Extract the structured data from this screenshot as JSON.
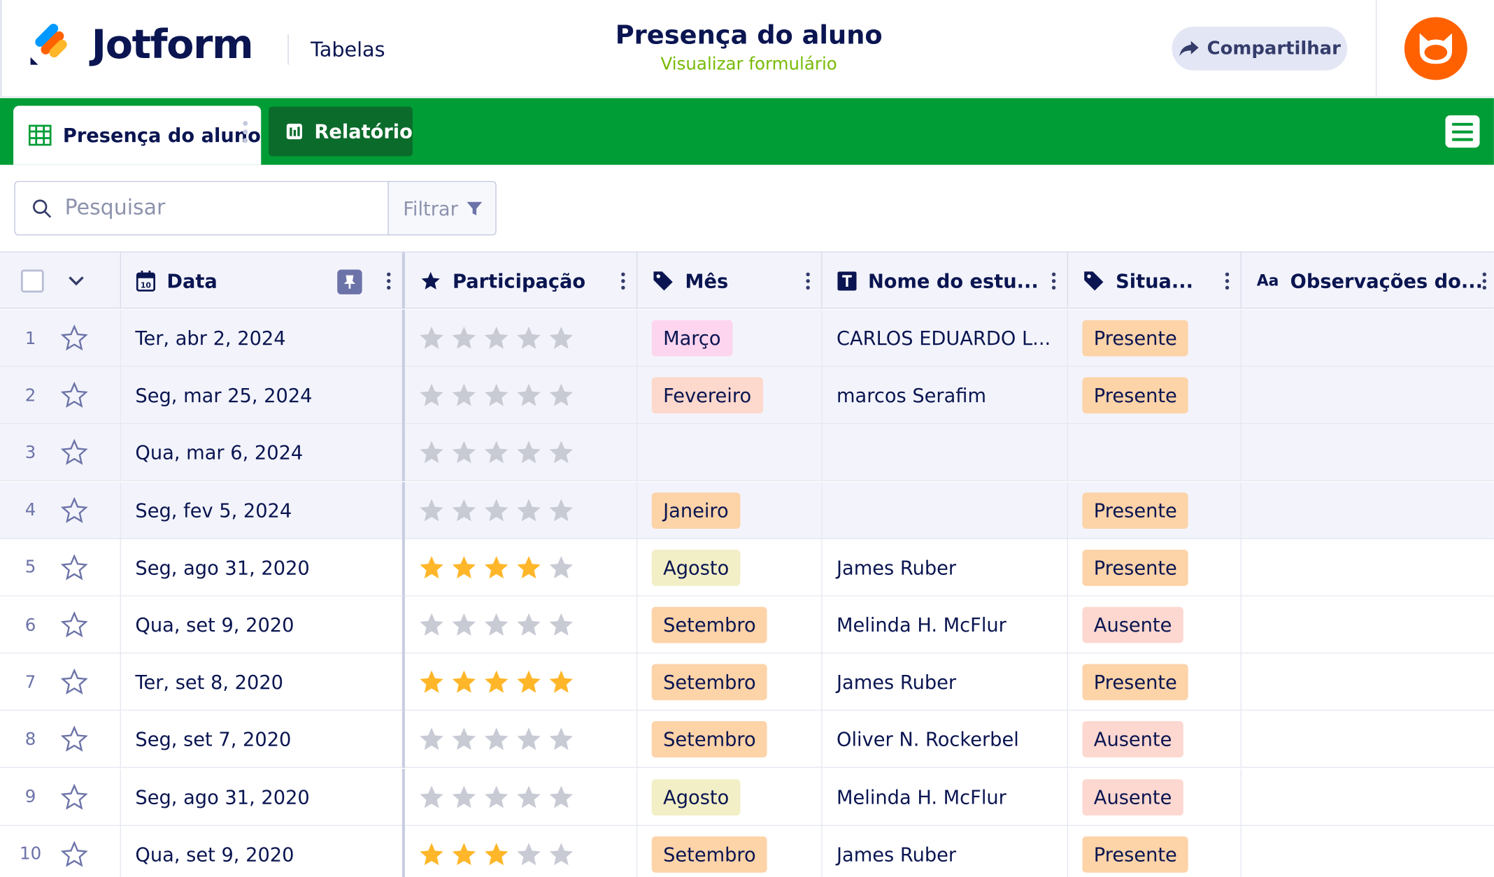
{
  "header": {
    "brand": "Jotform",
    "section": "Tabelas",
    "title": "Presença do aluno",
    "subtitle": "Visualizar formulário",
    "share_label": "Compartilhar"
  },
  "tabs": [
    {
      "label": "Presença do aluno"
    },
    {
      "label": "Relatório"
    }
  ],
  "search": {
    "placeholder": "Pesquisar",
    "filter_label": "Filtrar"
  },
  "columns": [
    {
      "label": "Data",
      "icon": "calendar-icon"
    },
    {
      "label": "Participação",
      "icon": "star-icon"
    },
    {
      "label": "Mês",
      "icon": "tag-icon"
    },
    {
      "label": "Nome do estu...",
      "icon": "text-icon"
    },
    {
      "label": "Situa...",
      "icon": "tag-icon"
    },
    {
      "label": "Observações do...",
      "icon": "text-aa-icon"
    }
  ],
  "rows": [
    {
      "num": "1",
      "date": "Ter, abr 2, 2024",
      "rating": 0,
      "month": "Março",
      "student": "CARLOS EDUARDO L...",
      "status": "Presente"
    },
    {
      "num": "2",
      "date": "Seg, mar 25, 2024",
      "rating": 0,
      "month": "Fevereiro",
      "student": "marcos Serafim",
      "status": "Presente"
    },
    {
      "num": "3",
      "date": "Qua, mar 6, 2024",
      "rating": 0,
      "month": "",
      "student": "",
      "status": ""
    },
    {
      "num": "4",
      "date": "Seg, fev 5, 2024",
      "rating": 0,
      "month": "Janeiro",
      "student": "",
      "status": "Presente"
    },
    {
      "num": "5",
      "date": "Seg, ago 31, 2020",
      "rating": 4,
      "month": "Agosto",
      "student": "James Ruber",
      "status": "Presente"
    },
    {
      "num": "6",
      "date": "Qua, set 9, 2020",
      "rating": 0,
      "month": "Setembro",
      "student": "Melinda H. McFlur",
      "status": "Ausente"
    },
    {
      "num": "7",
      "date": "Ter, set 8, 2020",
      "rating": 5,
      "month": "Setembro",
      "student": "James Ruber",
      "status": "Presente"
    },
    {
      "num": "8",
      "date": "Seg, set 7, 2020",
      "rating": 0,
      "month": "Setembro",
      "student": "Oliver N. Rockerbel",
      "status": "Ausente"
    },
    {
      "num": "9",
      "date": "Seg, ago 31, 2020",
      "rating": 0,
      "month": "Agosto",
      "student": "Melinda H. McFlur",
      "status": "Ausente"
    },
    {
      "num": "10",
      "date": "Qua, set 9, 2020",
      "rating": 3,
      "month": "Setembro",
      "student": "James Ruber",
      "status": "Presente"
    }
  ],
  "colors": {
    "brand_navy": "#0a1551",
    "green_bar": "#009c35",
    "subtitle_green": "#78bb07",
    "avatar_orange": "#ff6100",
    "star_filled": "#ffb629",
    "star_empty": "#c8cad4",
    "month_tags": {
      "Março": "#fdd5ee",
      "Fevereiro": "#fdd8cc",
      "Janeiro": "#fdd3a8",
      "Agosto": "#f2efc6",
      "Setembro": "#fdd3a8"
    },
    "status_tags": {
      "Presente": "#fdd3a8",
      "Ausente": "#fdd8d0"
    }
  }
}
